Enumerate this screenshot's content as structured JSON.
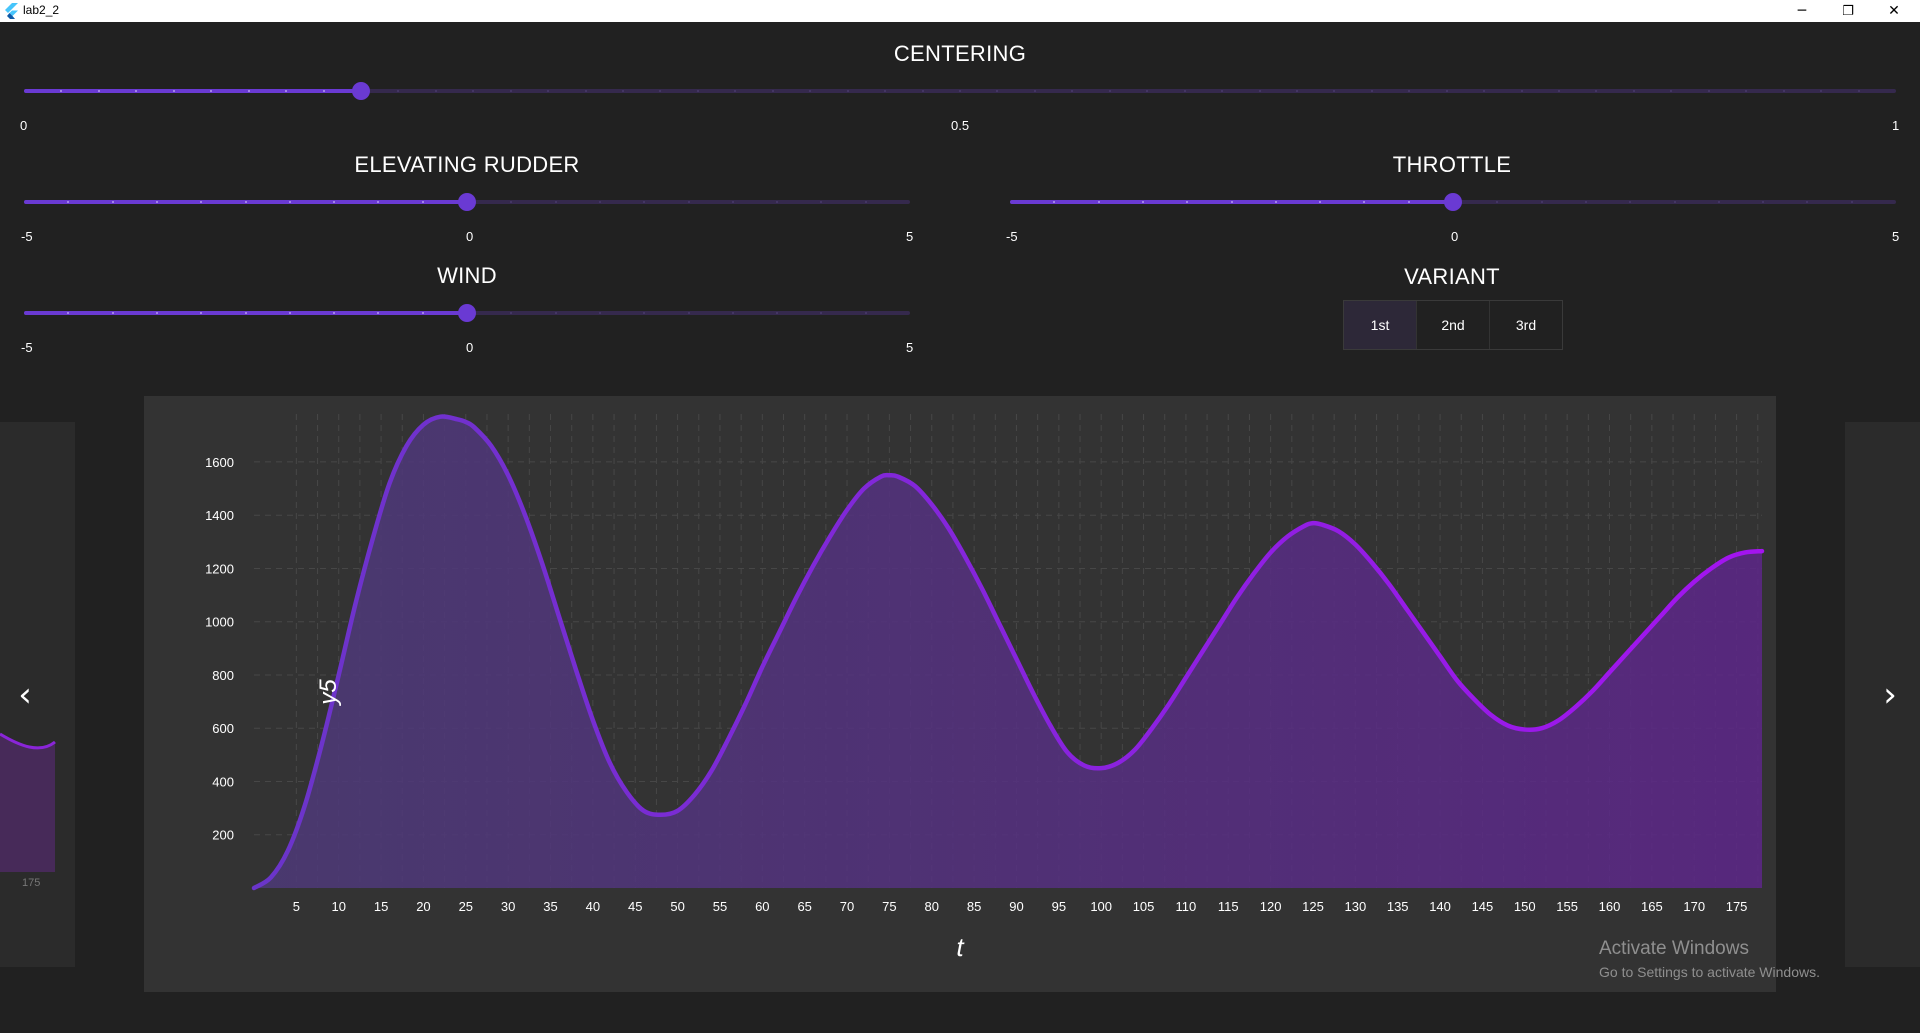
{
  "window": {
    "title": "lab2_2",
    "minimize": "─",
    "restore": "❐",
    "close": "✕"
  },
  "sliders": {
    "centering": {
      "title": "CENTERING",
      "min_label": "0",
      "mid_label": "0.5",
      "max_label": "1",
      "value": 0.18,
      "min": 0,
      "max": 1,
      "divisions": 50
    },
    "elevating_rudder": {
      "title": "ELEVATING RUDDER",
      "min_label": "-5",
      "mid_label": "0",
      "max_label": "5",
      "value": 0,
      "min": -5,
      "max": 5,
      "divisions": 20
    },
    "throttle": {
      "title": "THROTTLE",
      "min_label": "-5",
      "mid_label": "0",
      "max_label": "5",
      "value": 0,
      "min": -5,
      "max": 5,
      "divisions": 20
    },
    "wind": {
      "title": "WIND",
      "min_label": "-5",
      "mid_label": "0",
      "max_label": "5",
      "value": 0,
      "min": -5,
      "max": 5,
      "divisions": 20
    }
  },
  "variant": {
    "title": "VARIANT",
    "options": [
      "1st",
      "2nd",
      "3rd"
    ],
    "selected": "1st"
  },
  "colors": {
    "accent": "#6a3ad3",
    "line_start": "#6a35c9",
    "line_end": "#a314ef",
    "background": "#212121",
    "card": "#333333"
  },
  "nav": {
    "prev_icon": "chevron-left-icon",
    "next_icon": "chevron-right-icon",
    "prev_glyph": "‹",
    "next_glyph": "›"
  },
  "left_card": {
    "x_tick": "175"
  },
  "watermark": {
    "line1": "Activate Windows",
    "line2": "Go to Settings to activate Windows."
  },
  "chart_data": {
    "type": "area",
    "xlabel": "t",
    "ylabel": "y5",
    "x_ticks": [
      5,
      10,
      15,
      20,
      25,
      30,
      35,
      40,
      45,
      50,
      55,
      60,
      65,
      70,
      75,
      80,
      85,
      90,
      95,
      100,
      105,
      110,
      115,
      120,
      125,
      130,
      135,
      140,
      145,
      150,
      155,
      160,
      165,
      170,
      175
    ],
    "y_ticks": [
      200,
      400,
      600,
      800,
      1000,
      1200,
      1400,
      1600
    ],
    "xlim": [
      0,
      178
    ],
    "ylim": [
      0,
      1780
    ],
    "grid": true,
    "series": [
      {
        "x": [
          0,
          2,
          4,
          6,
          8,
          10,
          12,
          14,
          16,
          18,
          20,
          22,
          24,
          25,
          26,
          28,
          30,
          32,
          34,
          36,
          38,
          40,
          42,
          44,
          46,
          48,
          50,
          52,
          54,
          56,
          58,
          60,
          62,
          64,
          66,
          68,
          70,
          72,
          74,
          75,
          76,
          78,
          80,
          82,
          84,
          86,
          88,
          90,
          92,
          94,
          96,
          98,
          100,
          102,
          104,
          106,
          108,
          110,
          112,
          114,
          116,
          118,
          120,
          122,
          124,
          125,
          126,
          128,
          130,
          132,
          134,
          136,
          138,
          140,
          142,
          144,
          146,
          148,
          150,
          152,
          154,
          156,
          158,
          160,
          162,
          164,
          166,
          168,
          170,
          172,
          174,
          176,
          178
        ],
        "y": [
          0,
          40,
          140,
          310,
          540,
          800,
          1070,
          1310,
          1520,
          1660,
          1740,
          1770,
          1760,
          1750,
          1730,
          1660,
          1550,
          1400,
          1220,
          1020,
          820,
          630,
          470,
          360,
          290,
          275,
          290,
          350,
          440,
          560,
          690,
          830,
          960,
          1090,
          1210,
          1320,
          1420,
          1500,
          1545,
          1550,
          1545,
          1510,
          1440,
          1350,
          1240,
          1120,
          990,
          860,
          730,
          610,
          510,
          460,
          450,
          470,
          520,
          600,
          690,
          790,
          890,
          990,
          1090,
          1180,
          1260,
          1320,
          1360,
          1370,
          1365,
          1340,
          1290,
          1220,
          1140,
          1050,
          960,
          870,
          780,
          710,
          650,
          610,
          595,
          600,
          630,
          680,
          740,
          810,
          880,
          950,
          1020,
          1090,
          1150,
          1200,
          1240,
          1260,
          1265
        ]
      }
    ]
  }
}
